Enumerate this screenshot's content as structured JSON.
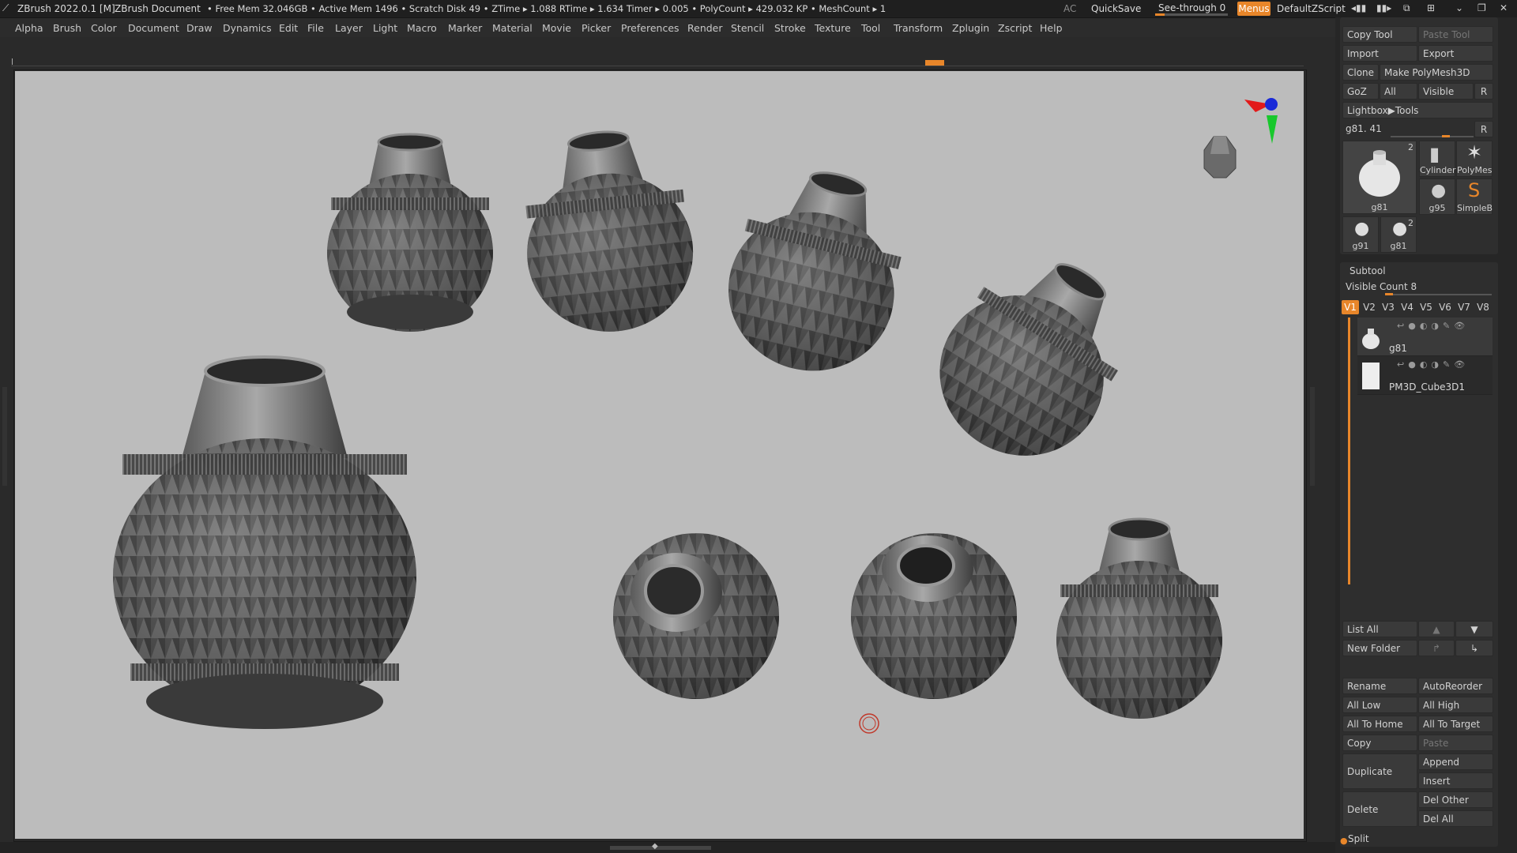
{
  "title_bar": {
    "app": "ZBrush 2022.0.1 [M]",
    "document": "ZBrush Document",
    "stats": "• Free Mem 32.046GB • Active Mem 1496 • Scratch Disk 49 •  ZTime ▸ 1.088 RTime ▸ 1.634 Timer ▸ 0.005 • PolyCount ▸ 429.032 KP  • MeshCount ▸ 1",
    "ac": "AC",
    "quicksave": "QuickSave",
    "see_through_label": "See-through  0",
    "see_through_value": 0,
    "menus": "Menus",
    "script": "DefaultZScript"
  },
  "menu": [
    "Alpha",
    "Brush",
    "Color",
    "Document",
    "Draw",
    "Dynamics",
    "Edit",
    "File",
    "Layer",
    "Light",
    "Macro",
    "Marker",
    "Material",
    "Movie",
    "Picker",
    "Preferences",
    "Render",
    "Stencil",
    "Stroke",
    "Texture",
    "Tool",
    "Transform",
    "Zplugin",
    "Zscript",
    "Help"
  ],
  "tool_panel": {
    "copy_tool": "Copy Tool",
    "paste_tool": "Paste Tool",
    "import": "Import",
    "export": "Export",
    "clone": "Clone",
    "make_polymesh": "Make PolyMesh3D",
    "goz": "GoZ",
    "all": "All",
    "visible": "Visible",
    "r": "R",
    "lightbox": "Lightbox▶Tools",
    "current_tool": "g81. 41",
    "thumbs": [
      {
        "label": "g81",
        "count": "2"
      },
      {
        "label": "Cylinder",
        "count": ""
      },
      {
        "label": "PolyMes",
        "count": ""
      },
      {
        "label": "g95",
        "count": ""
      },
      {
        "label": "SimpleB",
        "count": ""
      },
      {
        "label": "g91",
        "count": ""
      },
      {
        "label": "g81",
        "count": "2"
      }
    ]
  },
  "subtool": {
    "title": "Subtool",
    "visible_count": "Visible Count 8",
    "tabs": [
      "V1",
      "V2",
      "V3",
      "V4",
      "V5",
      "V6",
      "V7",
      "V8"
    ],
    "items": [
      {
        "name": "g81"
      },
      {
        "name": "PM3D_Cube3D1"
      }
    ],
    "list_all": "List All",
    "new_folder": "New Folder",
    "rename": "Rename",
    "autoreorder": "AutoReorder",
    "all_low": "All Low",
    "all_high": "All High",
    "all_to_home": "All To Home",
    "all_to_target": "All To Target",
    "copy": "Copy",
    "paste": "Paste",
    "duplicate": "Duplicate",
    "append": "Append",
    "insert": "Insert",
    "delete": "Delete",
    "del_other": "Del Other",
    "del_all": "Del All",
    "split": "Split"
  },
  "colors": {
    "accent": "#e8862a",
    "viewport_bg": "#bcbcbc",
    "ui_bg": "#2a2a2a"
  }
}
